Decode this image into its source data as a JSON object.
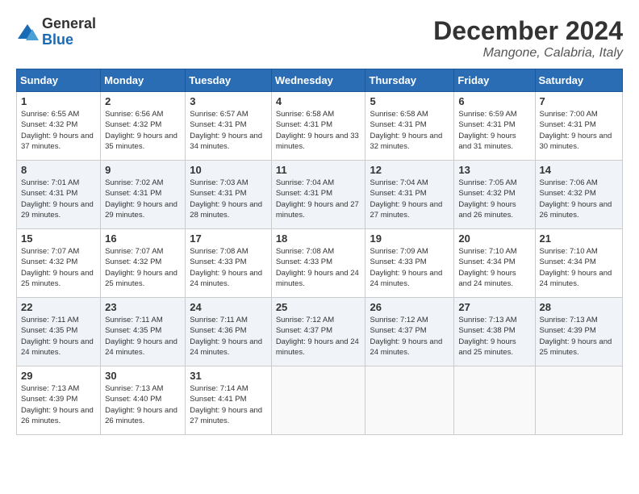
{
  "logo": {
    "general": "General",
    "blue": "Blue"
  },
  "title": "December 2024",
  "location": "Mangone, Calabria, Italy",
  "weekdays": [
    "Sunday",
    "Monday",
    "Tuesday",
    "Wednesday",
    "Thursday",
    "Friday",
    "Saturday"
  ],
  "weeks": [
    [
      {
        "day": "1",
        "sunrise": "6:55 AM",
        "sunset": "4:32 PM",
        "daylight": "9 hours and 37 minutes."
      },
      {
        "day": "2",
        "sunrise": "6:56 AM",
        "sunset": "4:32 PM",
        "daylight": "9 hours and 35 minutes."
      },
      {
        "day": "3",
        "sunrise": "6:57 AM",
        "sunset": "4:31 PM",
        "daylight": "9 hours and 34 minutes."
      },
      {
        "day": "4",
        "sunrise": "6:58 AM",
        "sunset": "4:31 PM",
        "daylight": "9 hours and 33 minutes."
      },
      {
        "day": "5",
        "sunrise": "6:58 AM",
        "sunset": "4:31 PM",
        "daylight": "9 hours and 32 minutes."
      },
      {
        "day": "6",
        "sunrise": "6:59 AM",
        "sunset": "4:31 PM",
        "daylight": "9 hours and 31 minutes."
      },
      {
        "day": "7",
        "sunrise": "7:00 AM",
        "sunset": "4:31 PM",
        "daylight": "9 hours and 30 minutes."
      }
    ],
    [
      {
        "day": "8",
        "sunrise": "7:01 AM",
        "sunset": "4:31 PM",
        "daylight": "9 hours and 29 minutes."
      },
      {
        "day": "9",
        "sunrise": "7:02 AM",
        "sunset": "4:31 PM",
        "daylight": "9 hours and 29 minutes."
      },
      {
        "day": "10",
        "sunrise": "7:03 AM",
        "sunset": "4:31 PM",
        "daylight": "9 hours and 28 minutes."
      },
      {
        "day": "11",
        "sunrise": "7:04 AM",
        "sunset": "4:31 PM",
        "daylight": "9 hours and 27 minutes."
      },
      {
        "day": "12",
        "sunrise": "7:04 AM",
        "sunset": "4:31 PM",
        "daylight": "9 hours and 27 minutes."
      },
      {
        "day": "13",
        "sunrise": "7:05 AM",
        "sunset": "4:32 PM",
        "daylight": "9 hours and 26 minutes."
      },
      {
        "day": "14",
        "sunrise": "7:06 AM",
        "sunset": "4:32 PM",
        "daylight": "9 hours and 26 minutes."
      }
    ],
    [
      {
        "day": "15",
        "sunrise": "7:07 AM",
        "sunset": "4:32 PM",
        "daylight": "9 hours and 25 minutes."
      },
      {
        "day": "16",
        "sunrise": "7:07 AM",
        "sunset": "4:32 PM",
        "daylight": "9 hours and 25 minutes."
      },
      {
        "day": "17",
        "sunrise": "7:08 AM",
        "sunset": "4:33 PM",
        "daylight": "9 hours and 24 minutes."
      },
      {
        "day": "18",
        "sunrise": "7:08 AM",
        "sunset": "4:33 PM",
        "daylight": "9 hours and 24 minutes."
      },
      {
        "day": "19",
        "sunrise": "7:09 AM",
        "sunset": "4:33 PM",
        "daylight": "9 hours and 24 minutes."
      },
      {
        "day": "20",
        "sunrise": "7:10 AM",
        "sunset": "4:34 PM",
        "daylight": "9 hours and 24 minutes."
      },
      {
        "day": "21",
        "sunrise": "7:10 AM",
        "sunset": "4:34 PM",
        "daylight": "9 hours and 24 minutes."
      }
    ],
    [
      {
        "day": "22",
        "sunrise": "7:11 AM",
        "sunset": "4:35 PM",
        "daylight": "9 hours and 24 minutes."
      },
      {
        "day": "23",
        "sunrise": "7:11 AM",
        "sunset": "4:35 PM",
        "daylight": "9 hours and 24 minutes."
      },
      {
        "day": "24",
        "sunrise": "7:11 AM",
        "sunset": "4:36 PM",
        "daylight": "9 hours and 24 minutes."
      },
      {
        "day": "25",
        "sunrise": "7:12 AM",
        "sunset": "4:37 PM",
        "daylight": "9 hours and 24 minutes."
      },
      {
        "day": "26",
        "sunrise": "7:12 AM",
        "sunset": "4:37 PM",
        "daylight": "9 hours and 24 minutes."
      },
      {
        "day": "27",
        "sunrise": "7:13 AM",
        "sunset": "4:38 PM",
        "daylight": "9 hours and 25 minutes."
      },
      {
        "day": "28",
        "sunrise": "7:13 AM",
        "sunset": "4:39 PM",
        "daylight": "9 hours and 25 minutes."
      }
    ],
    [
      {
        "day": "29",
        "sunrise": "7:13 AM",
        "sunset": "4:39 PM",
        "daylight": "9 hours and 26 minutes."
      },
      {
        "day": "30",
        "sunrise": "7:13 AM",
        "sunset": "4:40 PM",
        "daylight": "9 hours and 26 minutes."
      },
      {
        "day": "31",
        "sunrise": "7:14 AM",
        "sunset": "4:41 PM",
        "daylight": "9 hours and 27 minutes."
      },
      null,
      null,
      null,
      null
    ]
  ],
  "labels": {
    "sunrise": "Sunrise:",
    "sunset": "Sunset:",
    "daylight": "Daylight:"
  }
}
